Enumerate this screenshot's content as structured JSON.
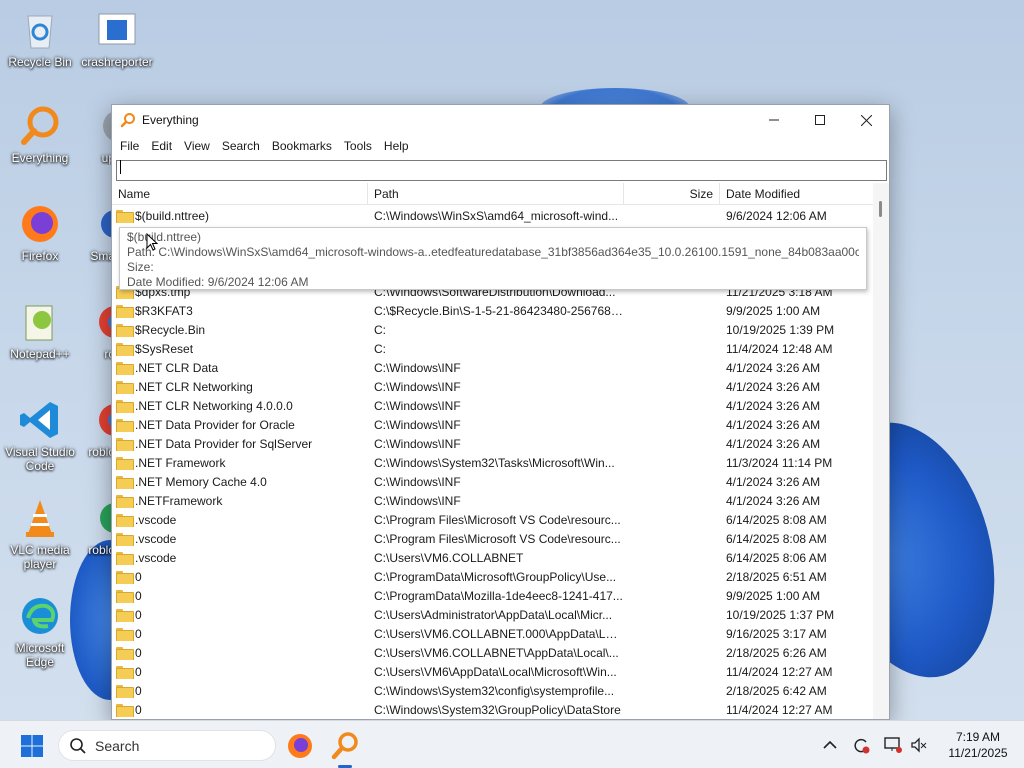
{
  "colors": {
    "accent": "#1e66d0",
    "folder": "#f5cd55",
    "everything_orange": "#f08a1c"
  },
  "desktop": {
    "icons": [
      {
        "label": "Recycle Bin",
        "icon": "recycle-bin-icon"
      },
      {
        "label": "crashreporter",
        "icon": "crashreporter-icon"
      },
      {
        "label": "Everything",
        "icon": "everything-search-icon"
      },
      {
        "label": "up",
        "icon": "updater-icon"
      },
      {
        "label": "Firefox",
        "icon": "firefox-icon"
      },
      {
        "label": "Sma",
        "icon": "smartscreen-icon"
      },
      {
        "label": "Notepad++",
        "icon": "notepadpp-icon"
      },
      {
        "label": "ro",
        "icon": "chrome-icon"
      },
      {
        "label": "Visual Studio Code",
        "icon": "vscode-icon"
      },
      {
        "label": "roblo",
        "icon": "chrome-icon"
      },
      {
        "label": "VLC media player",
        "icon": "vlc-icon"
      },
      {
        "label": "roblo",
        "icon": "roblox-icon"
      },
      {
        "label": "Microsoft Edge",
        "icon": "edge-icon"
      }
    ]
  },
  "window": {
    "title": "Everything",
    "menu": [
      "File",
      "Edit",
      "View",
      "Search",
      "Bookmarks",
      "Tools",
      "Help"
    ],
    "search": {
      "value": "",
      "placeholder": ""
    },
    "columns": {
      "name": "Name",
      "path": "Path",
      "size": "Size",
      "date": "Date Modified"
    },
    "rows": [
      {
        "name": "$(build.nttree)",
        "path": "C:\\Windows\\WinSxS\\amd64_microsoft-wind...",
        "size": "",
        "date": "9/6/2024 12:06 AM"
      },
      {
        "name": "",
        "path": "",
        "size": "",
        "date": ""
      },
      {
        "name": "",
        "path": "",
        "size": "",
        "date": ""
      },
      {
        "name": "",
        "path": "",
        "size": "",
        "date": ""
      },
      {
        "name": "$dpxs.tmp",
        "path": "C:\\Windows\\SoftwareDistribution\\Download...",
        "size": "",
        "date": "11/21/2025 3:18 AM"
      },
      {
        "name": "$R3KFAT3",
        "path": "C:\\$Recycle.Bin\\S-1-5-21-86423480-25676825...",
        "size": "",
        "date": "9/9/2025 1:00 AM"
      },
      {
        "name": "$Recycle.Bin",
        "path": "C:",
        "size": "",
        "date": "10/19/2025 1:39 PM"
      },
      {
        "name": "$SysReset",
        "path": "C:",
        "size": "",
        "date": "11/4/2024 12:48 AM"
      },
      {
        "name": ".NET CLR Data",
        "path": "C:\\Windows\\INF",
        "size": "",
        "date": "4/1/2024 3:26 AM"
      },
      {
        "name": ".NET CLR Networking",
        "path": "C:\\Windows\\INF",
        "size": "",
        "date": "4/1/2024 3:26 AM"
      },
      {
        "name": ".NET CLR Networking 4.0.0.0",
        "path": "C:\\Windows\\INF",
        "size": "",
        "date": "4/1/2024 3:26 AM"
      },
      {
        "name": ".NET Data Provider for Oracle",
        "path": "C:\\Windows\\INF",
        "size": "",
        "date": "4/1/2024 3:26 AM"
      },
      {
        "name": ".NET Data Provider for SqlServer",
        "path": "C:\\Windows\\INF",
        "size": "",
        "date": "4/1/2024 3:26 AM"
      },
      {
        "name": ".NET Framework",
        "path": "C:\\Windows\\System32\\Tasks\\Microsoft\\Win...",
        "size": "",
        "date": "11/3/2024 11:14 PM"
      },
      {
        "name": ".NET Memory Cache 4.0",
        "path": "C:\\Windows\\INF",
        "size": "",
        "date": "4/1/2024 3:26 AM"
      },
      {
        "name": ".NETFramework",
        "path": "C:\\Windows\\INF",
        "size": "",
        "date": "4/1/2024 3:26 AM"
      },
      {
        "name": ".vscode",
        "path": "C:\\Program Files\\Microsoft VS Code\\resourc...",
        "size": "",
        "date": "6/14/2025 8:08 AM"
      },
      {
        "name": ".vscode",
        "path": "C:\\Program Files\\Microsoft VS Code\\resourc...",
        "size": "",
        "date": "6/14/2025 8:08 AM"
      },
      {
        "name": ".vscode",
        "path": "C:\\Users\\VM6.COLLABNET",
        "size": "",
        "date": "6/14/2025 8:06 AM"
      },
      {
        "name": "0",
        "path": "C:\\ProgramData\\Microsoft\\GroupPolicy\\Use...",
        "size": "",
        "date": "2/18/2025 6:51 AM"
      },
      {
        "name": "0",
        "path": "C:\\ProgramData\\Mozilla-1de4eec8-1241-417...",
        "size": "",
        "date": "9/9/2025 1:00 AM"
      },
      {
        "name": "0",
        "path": "C:\\Users\\Administrator\\AppData\\Local\\Micr...",
        "size": "",
        "date": "10/19/2025 1:37 PM"
      },
      {
        "name": "0",
        "path": "C:\\Users\\VM6.COLLABNET.000\\AppData\\Loc...",
        "size": "",
        "date": "9/16/2025 3:17 AM"
      },
      {
        "name": "0",
        "path": "C:\\Users\\VM6.COLLABNET\\AppData\\Local\\...",
        "size": "",
        "date": "2/18/2025 6:26 AM"
      },
      {
        "name": "0",
        "path": "C:\\Users\\VM6\\AppData\\Local\\Microsoft\\Win...",
        "size": "",
        "date": "11/4/2024 12:27 AM"
      },
      {
        "name": "0",
        "path": "C:\\Windows\\System32\\config\\systemprofile...",
        "size": "",
        "date": "2/18/2025 6:42 AM"
      },
      {
        "name": "0",
        "path": "C:\\Windows\\System32\\GroupPolicy\\DataStore",
        "size": "",
        "date": "11/4/2024 12:27 AM"
      }
    ],
    "tooltip": {
      "name": "$(build.nttree)",
      "path": "Path: C:\\Windows\\WinSxS\\amd64_microsoft-windows-a..etedfeaturedatabase_31bf3856ad364e35_10.0.26100.1591_none_84b083aa00c60a75",
      "size": "Size:",
      "date": "Date Modified: 9/6/2024 12:06 AM"
    }
  },
  "taskbar": {
    "search_label": "Search",
    "time": "7:19 AM",
    "date": "11/21/2025"
  }
}
